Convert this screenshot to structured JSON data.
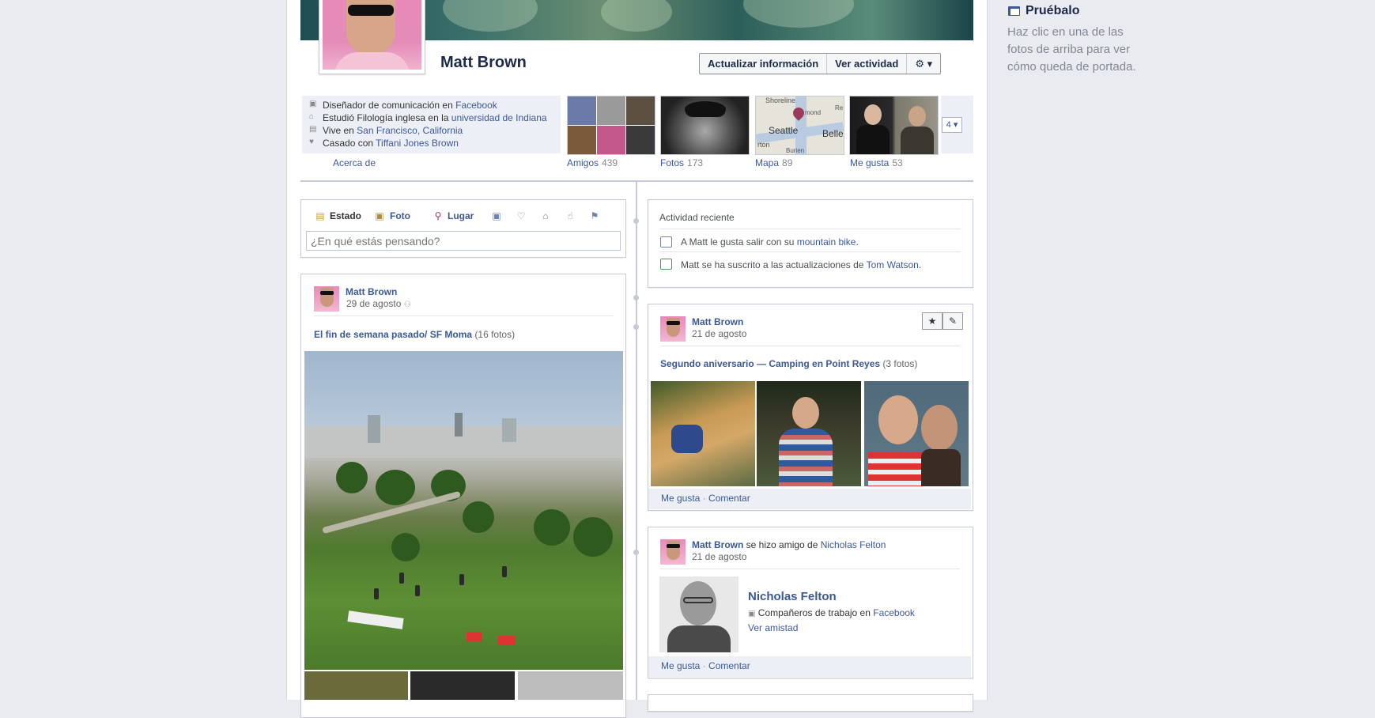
{
  "profile": {
    "name": "Matt Brown",
    "buttons": {
      "update_info": "Actualizar información",
      "activity": "Ver actividad",
      "gear": "⚙ ▾"
    }
  },
  "about": {
    "lines": [
      {
        "prefix": "Diseñador de comunicación en ",
        "link": "Facebook",
        "suffix": ""
      },
      {
        "prefix": "Estudió Filología inglesa en la ",
        "link": "universidad de Indiana",
        "suffix": ""
      },
      {
        "prefix": "Vive en ",
        "link": "San Francisco, California",
        "suffix": ""
      },
      {
        "prefix": "Casado con ",
        "link": "Tiffani Jones Brown",
        "suffix": ""
      }
    ],
    "label": "Acerca de"
  },
  "sections": {
    "friends": {
      "label": "Amigos",
      "count": "439"
    },
    "photos": {
      "label": "Fotos",
      "count": "173"
    },
    "map": {
      "label": "Mapa",
      "count": "89",
      "cities": [
        "Shoreline",
        "Seattle",
        "Belle",
        "rton",
        "Burien",
        "Re",
        "mond"
      ]
    },
    "likes": {
      "label": "Me gusta",
      "count": "53"
    },
    "more": "4 ▾"
  },
  "composer": {
    "tabs": [
      "Estado",
      "Foto",
      "Lugar"
    ],
    "placeholder": "¿En qué estás pensando?"
  },
  "recent": {
    "title": "Actividad reciente",
    "items": [
      {
        "prefix": "A Matt le gusta salir con su ",
        "link": "mountain bike",
        "suffix": "."
      },
      {
        "prefix": "Matt se ha suscrito a las actualizaciones de ",
        "link": "Tom Watson",
        "suffix": "."
      }
    ]
  },
  "posts": {
    "left": {
      "author": "Matt Brown",
      "date": "29 de agosto",
      "album_title": "El fin de semana pasado/ SF Moma",
      "album_count": "(16 fotos)"
    },
    "right1": {
      "author": "Matt Brown",
      "date": "21 de agosto",
      "album_title": "Segundo aniversario — Camping en Point Reyes",
      "album_count": "(3 fotos)",
      "actions": {
        "like": "Me gusta",
        "sep": " · ",
        "comment": "Comentar"
      }
    },
    "right2": {
      "author": "Matt Brown",
      "verb": " se hizo amigo de ",
      "friend": "Nicholas Felton",
      "date": "21 de agosto",
      "card_name": "Nicholas Felton",
      "card_work_prefix": "Compañeros de trabajo en ",
      "card_work_link": "Facebook",
      "card_action": "Ver amistad",
      "actions": {
        "like": "Me gusta",
        "sep": " · ",
        "comment": "Comentar"
      }
    }
  },
  "rail": {
    "title": "Pruébalo",
    "text": "Haz clic en una de las fotos de arriba para ver cómo queda de portada."
  },
  "colors": {
    "accent": "#3b5998",
    "background": "#e9ebf0",
    "border": "#c4cad6"
  }
}
